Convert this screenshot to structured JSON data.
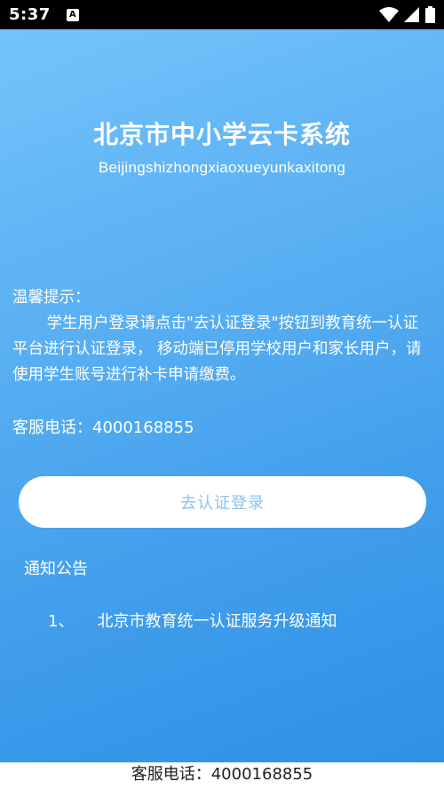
{
  "status_bar": {
    "time": "5:37",
    "icons": [
      "accessibility-icon",
      "wifi-icon",
      "signal-icon",
      "battery-icon"
    ]
  },
  "header": {
    "title": "北京市中小学云卡系统",
    "subtitle": "Beijingshizhongxiaoxueyunkaxitong"
  },
  "tips": {
    "heading": "温馨提示：",
    "body": "学生用户登录请点击\"去认证登录\"按钮到教育统一认证平台进行认证登录， 移动端已停用学校用户和家长用户，请使用学生账号进行补卡申请缴费。"
  },
  "service": {
    "text": "客服电话：4000168855"
  },
  "login": {
    "label": "去认证登录"
  },
  "notices": {
    "title": "通知公告",
    "items": [
      {
        "index": "1、",
        "text": "北京市教育统一认证服务升级通知"
      }
    ]
  },
  "footer": {
    "text": "客服电话：4000168855"
  },
  "colors": {
    "gradient_top": "#74c3fb",
    "gradient_bottom": "#2f90e6",
    "button_text": "#8cc2ec"
  }
}
